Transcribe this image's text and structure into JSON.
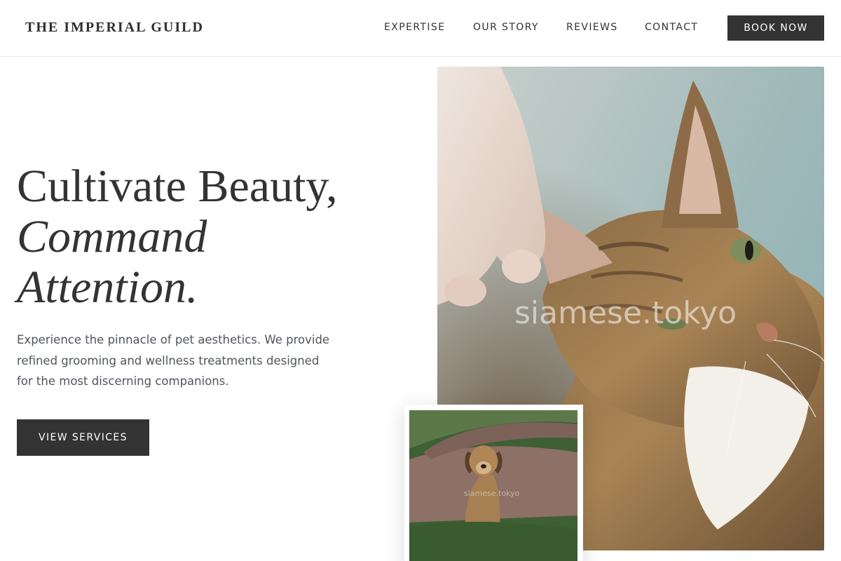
{
  "header": {
    "logo": "THE IMPERIAL GUILD",
    "nav": [
      {
        "label": "EXPERTISE"
      },
      {
        "label": "OUR STORY"
      },
      {
        "label": "REVIEWS"
      },
      {
        "label": "CONTACT"
      }
    ],
    "cta_label": "BOOK NOW"
  },
  "hero": {
    "title_line1": "Cultivate Beauty,",
    "title_line2": "Command",
    "title_line3": "Attention.",
    "description": "Experience the pinnacle of pet aesthetics. We provide refined grooming and wellness treatments designed for the most discerning companions.",
    "button_label": "VIEW SERVICES"
  },
  "images": {
    "main_watermark": "siamese.tokyo",
    "card_watermark": "siamese.tokyo"
  },
  "colors": {
    "primary_dark": "#333333",
    "background": "#ffffff",
    "body_text": "#50555c"
  }
}
